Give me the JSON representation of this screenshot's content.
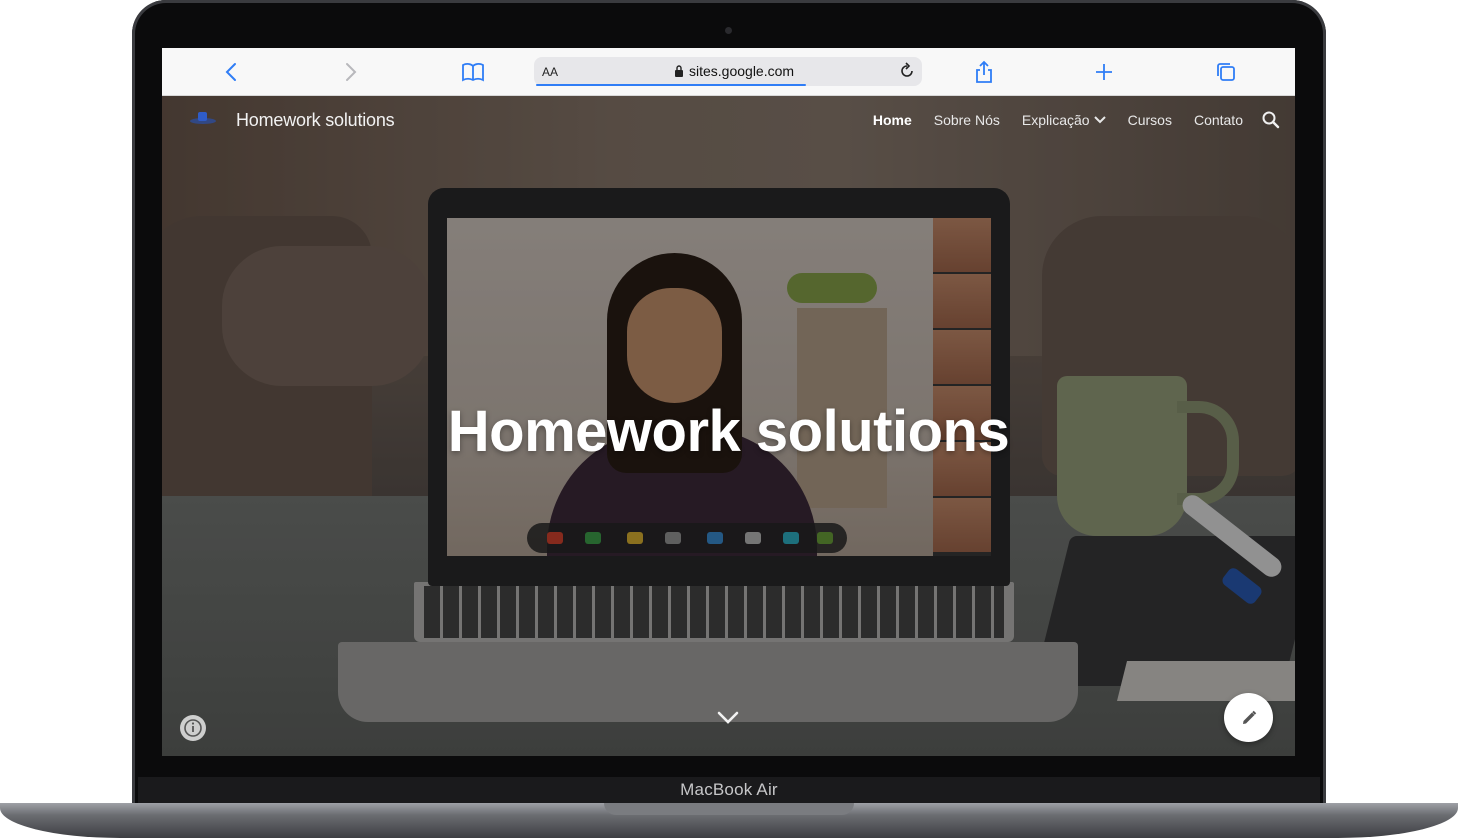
{
  "browser": {
    "text_size_label": "AA",
    "url": "sites.google.com"
  },
  "site": {
    "title": "Homework solutions",
    "nav": [
      {
        "label": "Home",
        "active": true
      },
      {
        "label": "Sobre Nós"
      },
      {
        "label": "Explicação",
        "has_dropdown": true
      },
      {
        "label": "Cursos"
      },
      {
        "label": "Contato"
      }
    ]
  },
  "hero": {
    "heading": "Homework solutions"
  },
  "device": {
    "model": "MacBook Air"
  },
  "colors": {
    "browser_accent": "#2f7df6",
    "nav_text": "#e8e8e8",
    "hero_text": "#ffffff"
  }
}
